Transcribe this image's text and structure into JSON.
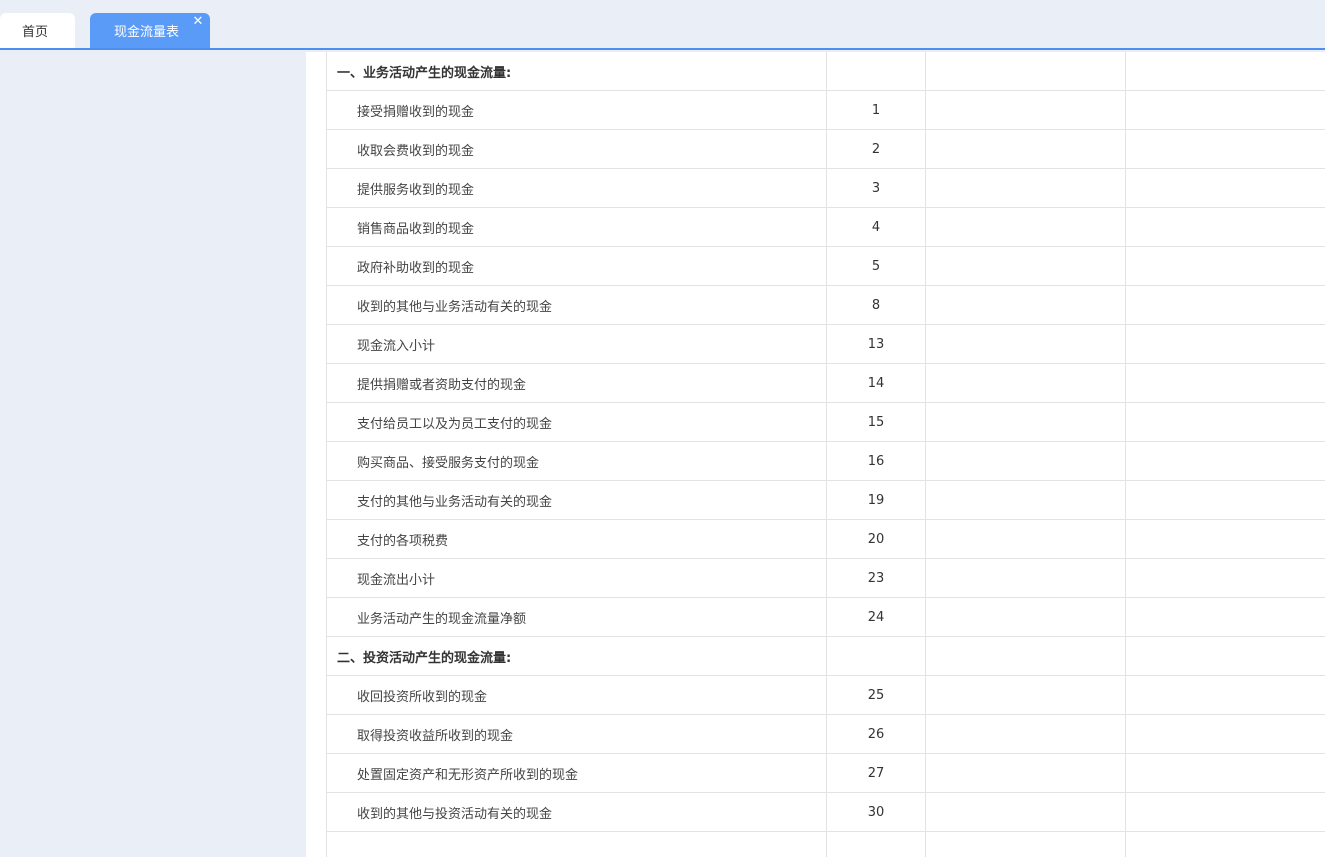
{
  "tabs": {
    "home_label": "首页",
    "cashflow_label": "现金流量表",
    "close_glyph": "✕"
  },
  "colors": {
    "accent": "#4d8ef5",
    "active_tab": "#5b9bf8",
    "background": "#e9eef7"
  },
  "report": {
    "rows": [
      {
        "type": "section",
        "name": "一、业务活动产生的现金流量:",
        "line": ""
      },
      {
        "type": "item",
        "name": "接受捐赠收到的现金",
        "line": "1"
      },
      {
        "type": "item",
        "name": "收取会费收到的现金",
        "line": "2"
      },
      {
        "type": "item",
        "name": "提供服务收到的现金",
        "line": "3"
      },
      {
        "type": "item",
        "name": "销售商品收到的现金",
        "line": "4"
      },
      {
        "type": "item",
        "name": "政府补助收到的现金",
        "line": "5"
      },
      {
        "type": "item",
        "name": "收到的其他与业务活动有关的现金",
        "line": "8"
      },
      {
        "type": "item",
        "name": "现金流入小计",
        "line": "13"
      },
      {
        "type": "item",
        "name": "提供捐赠或者资助支付的现金",
        "line": "14"
      },
      {
        "type": "item",
        "name": "支付给员工以及为员工支付的现金",
        "line": "15"
      },
      {
        "type": "item",
        "name": "购买商品、接受服务支付的现金",
        "line": "16"
      },
      {
        "type": "item",
        "name": "支付的其他与业务活动有关的现金",
        "line": "19"
      },
      {
        "type": "item",
        "name": "支付的各项税费",
        "line": "20"
      },
      {
        "type": "item",
        "name": "现金流出小计",
        "line": "23"
      },
      {
        "type": "item",
        "name": "业务活动产生的现金流量净额",
        "line": "24"
      },
      {
        "type": "section",
        "name": "二、投资活动产生的现金流量:",
        "line": ""
      },
      {
        "type": "item",
        "name": "收回投资所收到的现金",
        "line": "25"
      },
      {
        "type": "item",
        "name": "取得投资收益所收到的现金",
        "line": "26"
      },
      {
        "type": "item",
        "name": "处置固定资产和无形资产所收到的现金",
        "line": "27"
      },
      {
        "type": "item",
        "name": "收到的其他与投资活动有关的现金",
        "line": "30"
      },
      {
        "type": "item",
        "name": "",
        "line": ""
      }
    ]
  }
}
